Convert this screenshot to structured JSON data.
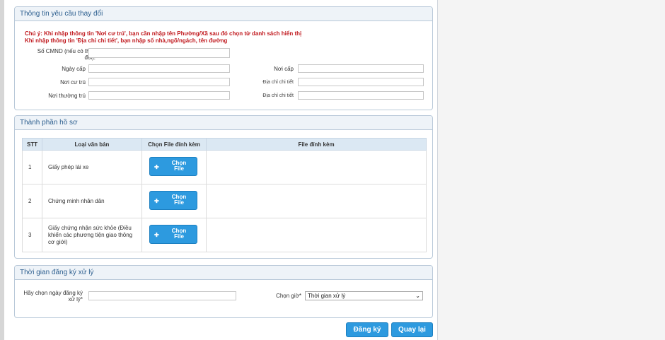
{
  "section_info": {
    "title": "Thông tin yêu cầu thay đổi",
    "notes": [
      "Chú ý: Khi nhập thông tin 'Nơi cư trú', bạn cần nhập tên Phường/Xã sau đó chọn từ danh sách hiển thị",
      "Khi nhập thông tin 'Địa chỉ chi tiết', bạn nhập số nhà,ngõ/ngách, tên đường"
    ],
    "fields": {
      "cmnd_label": "Số CMND (nếu có thay đổi):",
      "ngay_cap_label": "Ngày cấp",
      "noi_cap_label": "Nơi cấp",
      "noi_cu_tru_label": "Nơi cư trú",
      "dia_chi_chi_tiet_label": "Địa chỉ chi tiết",
      "noi_thuong_tru_label": "Nơi thường trú",
      "dia_chi_chi_tiet_2_label": "Địa chỉ chi tiết"
    }
  },
  "section_docs": {
    "title": "Thành phần hồ sơ",
    "columns": [
      "STT",
      "Loại văn bản",
      "Chọn File đính kèm",
      "File đính kèm"
    ],
    "rows": [
      {
        "stt": "1",
        "type": "Giấy phép lái xe",
        "button": "Chọn File",
        "file": ""
      },
      {
        "stt": "2",
        "type": "Chứng minh nhân dân",
        "button": "Chọn File",
        "file": ""
      },
      {
        "stt": "3",
        "type": "Giấy chứng nhận sức khỏe (Điều khiển các phương tiện giao thông cơ giới)",
        "button": "Chọn File",
        "file": ""
      }
    ]
  },
  "section_time": {
    "title": "Thời gian đăng ký xử lý",
    "date_label": "Hãy chọn ngày đăng ký xử lý*",
    "hour_label": "Chọn giờ*",
    "hour_select_value": "Thời gian xử lý"
  },
  "actions": {
    "register": "Đăng ký",
    "back": "Quay lại"
  },
  "colors": {
    "accent": "#2d9adf",
    "panel_border": "#b9c9d9",
    "header_text": "#2d5f8f",
    "warning": "#c0181d"
  }
}
